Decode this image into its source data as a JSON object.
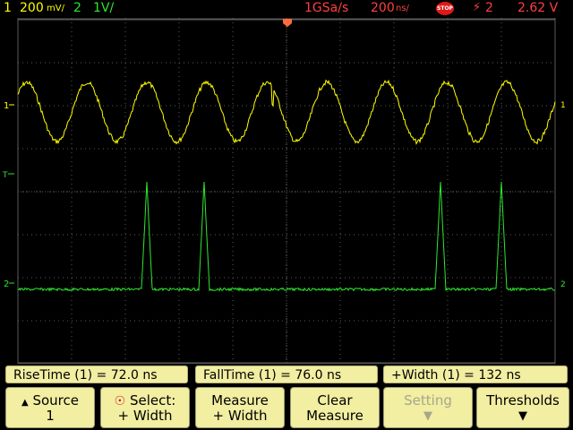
{
  "status": {
    "ch1_num": "1",
    "ch1_scale": "200",
    "ch1_unit": "mV/",
    "ch2_num": "2",
    "ch2_scale": "1V/",
    "sample_rate": "1GSa/s",
    "timebase": "200",
    "timebase_unit": "ns/",
    "run_state": "STOP",
    "trigger_source": "2",
    "trigger_level": "2.62 V"
  },
  "markers": {
    "ch1": "1",
    "ch2": "2",
    "trigger": "T"
  },
  "measurements": [
    {
      "label": "RiseTime",
      "channel": "1",
      "value": "72.0 ns"
    },
    {
      "label": "FallTime",
      "channel": "1",
      "value": "76.0 ns"
    },
    {
      "label": "+Width",
      "channel": "1",
      "value": "132 ns"
    }
  ],
  "softkeys": [
    {
      "line1": "Source",
      "line2": "1"
    },
    {
      "line1": "Select:",
      "line2": "+ Width"
    },
    {
      "line1": "Measure",
      "line2": "+ Width"
    },
    {
      "line1": "Clear",
      "line2": "Measure"
    },
    {
      "line1": "Setting",
      "line2": ""
    },
    {
      "line1": "Thresholds",
      "line2": ""
    }
  ],
  "colors": {
    "ch1": "#ffff00",
    "ch2": "#2ee62e",
    "grid": "#5a5a5a",
    "softkey_bg": "#f2eea2"
  }
}
